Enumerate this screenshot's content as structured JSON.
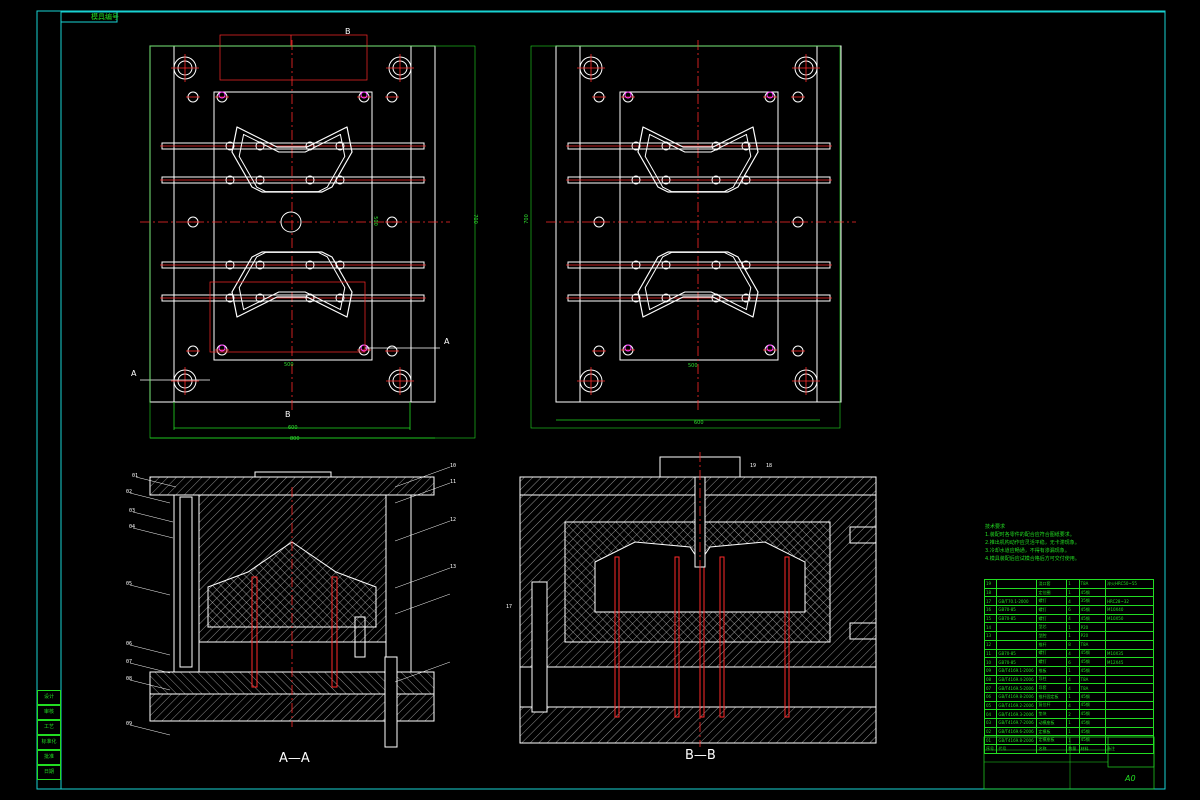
{
  "drawing": {
    "title_tag": "模具编号",
    "section_a_label": "A—A",
    "section_b_label": "B—B",
    "cut_markers": {
      "a": "A",
      "b": "B"
    },
    "format": "A0",
    "colors": {
      "frame": "#19d3d3",
      "outline": "#ffffff",
      "centerline": "#ff2a2a",
      "dimension": "#22dd22",
      "hatch": "#cfcfcf",
      "pin": "#ff3aff",
      "table": "#22dd22"
    }
  },
  "top_view_dims": {
    "overall_height": "700",
    "insert_width": "500",
    "overall_width": "600",
    "base_width": "800",
    "insert_height": "500"
  },
  "bom": {
    "rows": [
      {
        "no": "19",
        "code": "",
        "name": "浇口套",
        "qty": "1",
        "mat": "T8A",
        "note": "淬火HRC50~55"
      },
      {
        "no": "18",
        "code": "",
        "name": "定位圈",
        "qty": "1",
        "mat": "45钢",
        "note": ""
      },
      {
        "no": "17",
        "code": "GB/T70.1-2000",
        "name": "螺钉",
        "qty": "4",
        "mat": "35钢",
        "note": "HRC28~32"
      },
      {
        "no": "16",
        "code": "GB70-85",
        "name": "螺钉",
        "qty": "6",
        "mat": "45钢",
        "note": "M10X40"
      },
      {
        "no": "15",
        "code": "GB70-85",
        "name": "螺钉",
        "qty": "4",
        "mat": "45钢",
        "note": "M10X50"
      },
      {
        "no": "14",
        "code": "",
        "name": "型芯",
        "qty": "1",
        "mat": "P20",
        "note": ""
      },
      {
        "no": "13",
        "code": "",
        "name": "型腔",
        "qty": "1",
        "mat": "P20",
        "note": ""
      },
      {
        "no": "12",
        "code": "",
        "name": "推杆",
        "qty": "8",
        "mat": "T8A",
        "note": ""
      },
      {
        "no": "11",
        "code": "GB70-85",
        "name": "螺钉",
        "qty": "4",
        "mat": "45钢",
        "note": "M10X35"
      },
      {
        "no": "10",
        "code": "GB70-85",
        "name": "螺钉",
        "qty": "6",
        "mat": "45钢",
        "note": "M12X45"
      },
      {
        "no": "09",
        "code": "GB/T4169.1-2006",
        "name": "推板",
        "qty": "1",
        "mat": "45钢",
        "note": ""
      },
      {
        "no": "08",
        "code": "GB/T4169.4-2006",
        "name": "导柱",
        "qty": "4",
        "mat": "T8A",
        "note": ""
      },
      {
        "no": "07",
        "code": "GB/T4169.5-2006",
        "name": "导套",
        "qty": "4",
        "mat": "T8A",
        "note": ""
      },
      {
        "no": "06",
        "code": "GB/T4169.8-2006",
        "name": "推杆固定板",
        "qty": "1",
        "mat": "45钢",
        "note": ""
      },
      {
        "no": "05",
        "code": "GB/T4169.2-2006",
        "name": "复位杆",
        "qty": "4",
        "mat": "45钢",
        "note": ""
      },
      {
        "no": "04",
        "code": "GB/T4169.3-2006",
        "name": "垫块",
        "qty": "2",
        "mat": "45钢",
        "note": ""
      },
      {
        "no": "03",
        "code": "GB/T4169.7-2006",
        "name": "动模座板",
        "qty": "1",
        "mat": "45钢",
        "note": ""
      },
      {
        "no": "02",
        "code": "GB/T4169.6-2006",
        "name": "定模板",
        "qty": "1",
        "mat": "45钢",
        "note": ""
      },
      {
        "no": "01",
        "code": "GB/T4169.8-2006",
        "name": "定模座板",
        "qty": "1",
        "mat": "45钢",
        "note": ""
      }
    ],
    "headers": [
      "序号",
      "代号",
      "名称",
      "数量",
      "材料",
      "备注"
    ],
    "notes_title": "技术要求",
    "notes": [
      "1.装配时各零件的配合应符合图纸要求。",
      "2.推出机构动作应灵活平稳，无卡滞现象。",
      "3.冷却水道应畅通，不得有渗漏现象。",
      "4.模具装配后应试模合格后方可交付使用。"
    ]
  },
  "left_block_labels": [
    "设计",
    "审核",
    "工艺",
    "标准化",
    "批准",
    "日期"
  ],
  "leader_numbers_aa": [
    "01",
    "02",
    "03",
    "04",
    "05",
    "06",
    "07",
    "08",
    "09",
    "10",
    "11",
    "12",
    "13"
  ],
  "leader_numbers_bb": [
    "19",
    "18",
    "17"
  ]
}
